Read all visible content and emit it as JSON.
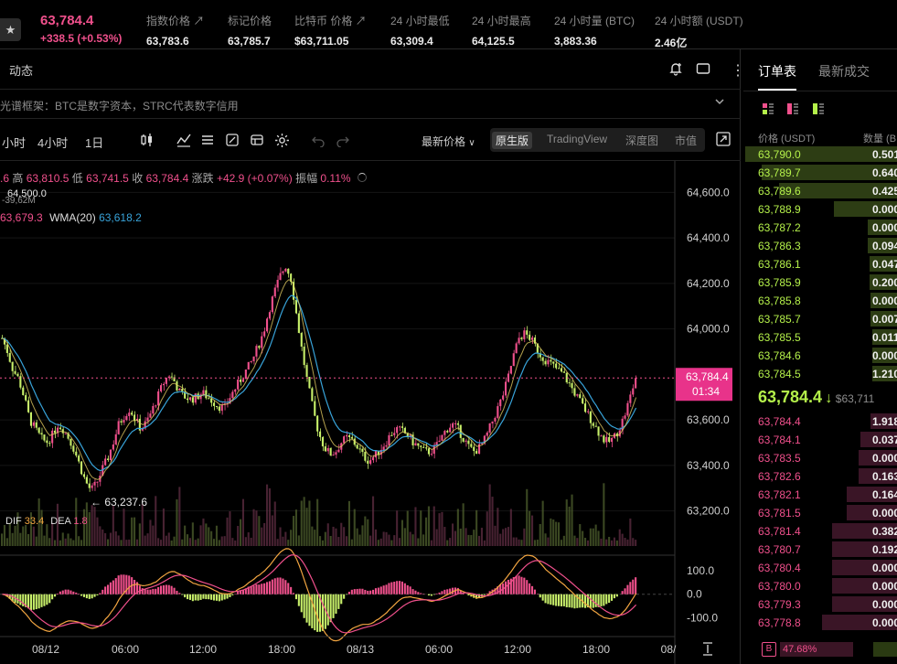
{
  "ticker": {
    "price": "63,784.4",
    "change": "+338.5 (+0.53%)"
  },
  "stats": [
    {
      "label": "指数价格 ↗",
      "value": "63,783.6"
    },
    {
      "label": "标记价格",
      "value": "63,785.7"
    },
    {
      "label": "比特币 价格 ↗",
      "value": "$63,711.05"
    },
    {
      "label": "24 小时最低",
      "value": "63,309.4"
    },
    {
      "label": "24 小时最高",
      "value": "64,125.5"
    },
    {
      "label": "24 小时量 (BTC)",
      "value": "3,883.36"
    },
    {
      "label": "24 小时额 (USDT)",
      "value": "2.46亿"
    }
  ],
  "panel": {
    "title": "动态",
    "news": "光谱框架：BTC是数字资本，STRC代表数字信用"
  },
  "toolbar": {
    "intervals": [
      "小时",
      "4小时",
      "1日"
    ],
    "price_type": "最新价格",
    "views": [
      "原生版",
      "TradingView",
      "深度图",
      "市值"
    ]
  },
  "ohlc": {
    "o_tail": ".6",
    "h_label": "高",
    "h": "63,810.5",
    "l_label": "低",
    "l": "63,741.5",
    "c_label": "收",
    "c": "63,784.4",
    "chg_label": "涨跌",
    "chg": "+42.9 (+0.07%)",
    "amp_label": "振幅",
    "amp": "0.11%"
  },
  "ma": {
    "ma_val": "63,679.3",
    "wma_label": "WMA(20)",
    "wma_val": "63,618.2",
    "ghost1": "64,500.0",
    "ghost2": "-39,62M"
  },
  "macd": {
    "dif_label": "DIF",
    "dif": "33.4",
    "dea_label": "DEA",
    "dea": "1.8"
  },
  "price_axis": [
    "64,600.0",
    "64,400.0",
    "64,200.0",
    "64,000.0",
    "63,600.0",
    "63,400.0",
    "63,200.0"
  ],
  "current_price_tag": {
    "price": "63,784.4",
    "countdown": "01:34"
  },
  "macd_axis": [
    "100.0",
    "0.0",
    "-100.0"
  ],
  "time_axis": [
    "08/12",
    "06:00",
    "12:00",
    "18:00",
    "08/13",
    "06:00",
    "12:00",
    "18:00",
    "08/"
  ],
  "min_marker": "← 63,237.6",
  "chart_data": {
    "type": "candlestick",
    "y_range": [
      63150,
      64650
    ],
    "price_ticks": [
      64600,
      64400,
      64200,
      64000,
      63600,
      63400,
      63200
    ],
    "last_price": 63784.4,
    "min_marker": 63237.6,
    "close_path": [
      63960,
      63900,
      63820,
      63780,
      63700,
      63600,
      63560,
      63520,
      63500,
      63530,
      63580,
      63560,
      63520,
      63470,
      63400,
      63330,
      63290,
      63320,
      63380,
      63430,
      63500,
      63580,
      63620,
      63650,
      63600,
      63560,
      63590,
      63640,
      63700,
      63760,
      63800,
      63770,
      63720,
      63700,
      63690,
      63700,
      63720,
      63700,
      63680,
      63660,
      63650,
      63700,
      63740,
      63780,
      63820,
      63860,
      63920,
      63980,
      64080,
      64160,
      64230,
      64280,
      64220,
      64060,
      63900,
      63760,
      63640,
      63540,
      63480,
      63450,
      63460,
      63500,
      63520,
      63510,
      63480,
      63440,
      63420,
      63440,
      63470,
      63500,
      63540,
      63560,
      63550,
      63530,
      63500,
      63480,
      63460,
      63460,
      63480,
      63520,
      63560,
      63580,
      63560,
      63520,
      63480,
      63460,
      63480,
      63520,
      63580,
      63640,
      63700,
      63780,
      63880,
      63960,
      63980,
      63960,
      63920,
      63880,
      63860,
      63840,
      63820,
      63800,
      63760,
      63720,
      63680,
      63640,
      63600,
      63560,
      63520,
      63500,
      63520,
      63560,
      63620,
      63700,
      63784
    ],
    "macd_range": [
      -160,
      150
    ],
    "macd_ticks": [
      100,
      0,
      -100
    ]
  },
  "orderbook": {
    "tabs": [
      "订单表",
      "最新成交"
    ],
    "col_price": "价格 (USDT)",
    "col_qty": "数量 (B",
    "asks": [
      {
        "price": "63,790.0",
        "qty": "0.501",
        "depth": 0.99
      },
      {
        "price": "63,789.7",
        "qty": "0.640",
        "depth": 0.88
      },
      {
        "price": "63,789.6",
        "qty": "0.425",
        "depth": 0.77
      },
      {
        "price": "63,788.9",
        "qty": "0.000",
        "depth": 0.41
      },
      {
        "price": "63,787.2",
        "qty": "0.000",
        "depth": 0.19
      },
      {
        "price": "63,786.3",
        "qty": "0.094",
        "depth": 0.19
      },
      {
        "price": "63,786.1",
        "qty": "0.047",
        "depth": 0.18
      },
      {
        "price": "63,785.9",
        "qty": "0.200",
        "depth": 0.18
      },
      {
        "price": "63,785.8",
        "qty": "0.000",
        "depth": 0.17
      },
      {
        "price": "63,785.7",
        "qty": "0.007",
        "depth": 0.17
      },
      {
        "price": "63,785.5",
        "qty": "0.011",
        "depth": 0.16
      },
      {
        "price": "63,784.6",
        "qty": "0.000",
        "depth": 0.16
      },
      {
        "price": "63,784.5",
        "qty": "1.210",
        "depth": 0.16
      }
    ],
    "mid_price": "63,784.4",
    "mid_arrow": "↓",
    "mid_usd": "$63,711",
    "bids": [
      {
        "price": "63,784.4",
        "qty": "1.918",
        "depth": 0.17
      },
      {
        "price": "63,784.1",
        "qty": "0.037",
        "depth": 0.24
      },
      {
        "price": "63,783.5",
        "qty": "0.000",
        "depth": 0.25
      },
      {
        "price": "63,782.6",
        "qty": "0.163",
        "depth": 0.25
      },
      {
        "price": "63,782.1",
        "qty": "0.164",
        "depth": 0.33
      },
      {
        "price": "63,781.5",
        "qty": "0.000",
        "depth": 0.33
      },
      {
        "price": "63,781.4",
        "qty": "0.382",
        "depth": 0.42
      },
      {
        "price": "63,780.7",
        "qty": "0.192",
        "depth": 0.42
      },
      {
        "price": "63,780.4",
        "qty": "0.000",
        "depth": 0.42
      },
      {
        "price": "63,780.0",
        "qty": "0.000",
        "depth": 0.42
      },
      {
        "price": "63,779.3",
        "qty": "0.000",
        "depth": 0.42
      },
      {
        "price": "63,778.8",
        "qty": "0.000",
        "depth": 0.49
      }
    ],
    "ratio_badge": "B",
    "ratio": "47.68%"
  }
}
